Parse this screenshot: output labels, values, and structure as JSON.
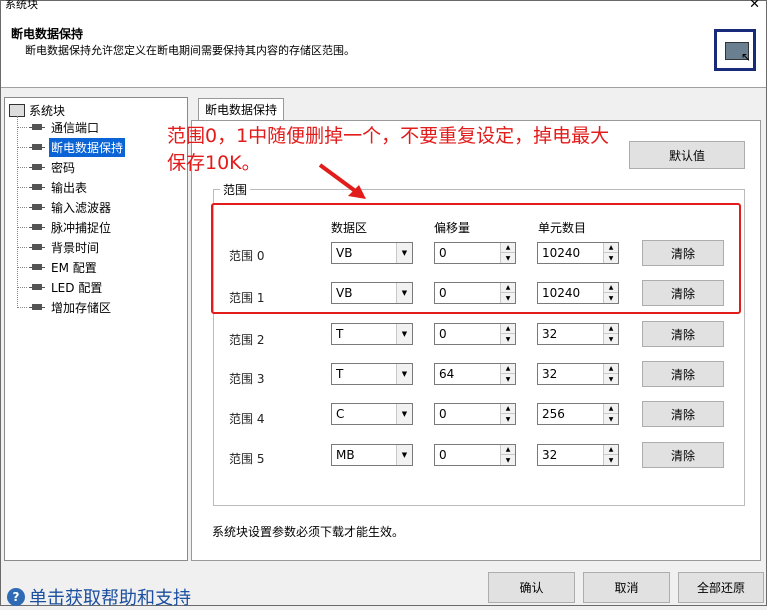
{
  "window": {
    "title": "系统块",
    "close": "✕"
  },
  "header": {
    "title": "断电数据保持",
    "description": "断电数据保持允许您定义在断电期间需要保持其内容的存储区范围。"
  },
  "tree": {
    "root": "系统块",
    "items": [
      {
        "label": "通信端口"
      },
      {
        "label": "断电数据保持"
      },
      {
        "label": "密码"
      },
      {
        "label": "输出表"
      },
      {
        "label": "输入滤波器"
      },
      {
        "label": "脉冲捕捉位"
      },
      {
        "label": "背景时间"
      },
      {
        "label": "EM 配置"
      },
      {
        "label": "LED 配置"
      },
      {
        "label": "增加存储区"
      }
    ]
  },
  "tab": {
    "label": "断电数据保持"
  },
  "default_button": "默认值",
  "group": {
    "label": "范围"
  },
  "columns": {
    "area": "数据区",
    "offset": "偏移量",
    "count": "单元数目"
  },
  "rows": [
    {
      "label": "范围 0",
      "area": "VB",
      "offset": "0",
      "count": "10240",
      "clear": "清除"
    },
    {
      "label": "范围 1",
      "area": "VB",
      "offset": "0",
      "count": "10240",
      "clear": "清除"
    },
    {
      "label": "范围 2",
      "area": "T",
      "offset": "0",
      "count": "32",
      "clear": "清除"
    },
    {
      "label": "范围 3",
      "area": "T",
      "offset": "64",
      "count": "32",
      "clear": "清除"
    },
    {
      "label": "范围 4",
      "area": "C",
      "offset": "0",
      "count": "256",
      "clear": "清除"
    },
    {
      "label": "范围 5",
      "area": "MB",
      "offset": "0",
      "count": "32",
      "clear": "清除"
    }
  ],
  "note": "系统块设置参数必须下载才能生效。",
  "annotation": {
    "line1": "范围0，1中随便删掉一个，不要重复设定，掉电最大",
    "line2": "保存10K。",
    "color": "#e21b1b"
  },
  "footer": {
    "help": "单击获取帮助和支持",
    "ok": "确认",
    "cancel": "取消",
    "reset": "全部还原"
  }
}
